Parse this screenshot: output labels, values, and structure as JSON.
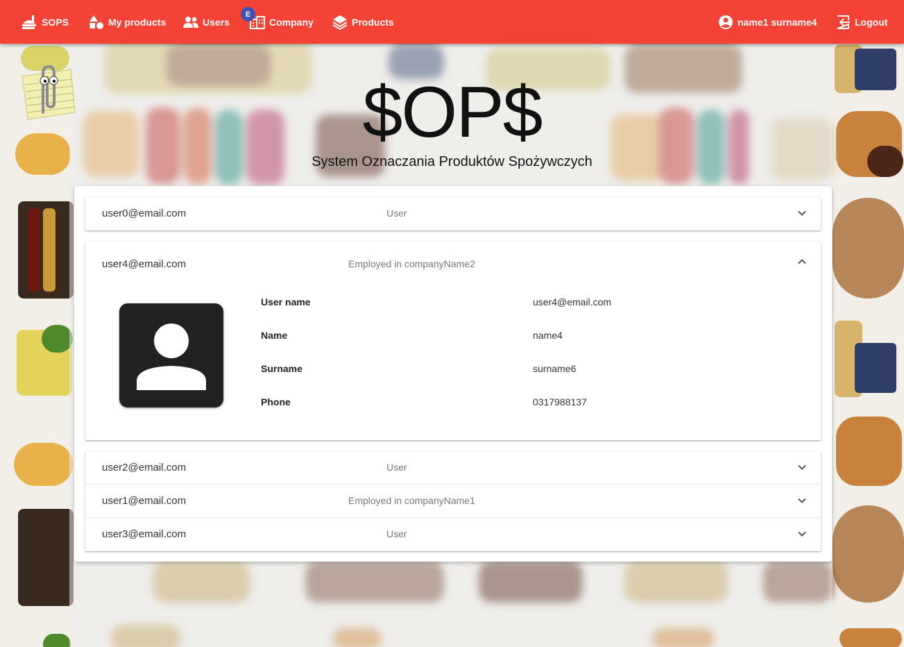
{
  "nav": {
    "brand": "SOPS",
    "my_products": "My products",
    "users": "Users",
    "company": "Company",
    "company_badge": "E",
    "products": "Products",
    "user_name": "name1 surname4",
    "logout": "Logout"
  },
  "header": {
    "logo": "$OP$",
    "subtitle": "System Oznaczania Produktów Spożywczych"
  },
  "users": [
    {
      "email": "user0@email.com",
      "role": "User"
    },
    {
      "email": "user4@email.com",
      "role": "Employed in companyName2"
    },
    {
      "email": "user2@email.com",
      "role": "User"
    },
    {
      "email": "user1@email.com",
      "role": "Employed in companyName1"
    },
    {
      "email": "user3@email.com",
      "role": "User"
    }
  ],
  "details": {
    "username_label": "User name",
    "username_value": "user4@email.com",
    "name_label": "Name",
    "name_value": "name4",
    "surname_label": "Surname",
    "surname_value": "surname6",
    "phone_label": "Phone",
    "phone_value": "0317988137"
  },
  "colors": {
    "appbar": "#f44336",
    "badge": "#3f51b5",
    "avatar_bg": "#212121"
  },
  "icons": {
    "brand": "food-tray-icon",
    "my_products": "shapes-icon",
    "users": "users-icon",
    "company": "building-icon",
    "products": "layers-icon",
    "account": "account-circle-icon",
    "logout": "logout-icon",
    "expand": "chevron-down-icon",
    "collapse": "chevron-up-icon",
    "avatar": "person-icon"
  }
}
